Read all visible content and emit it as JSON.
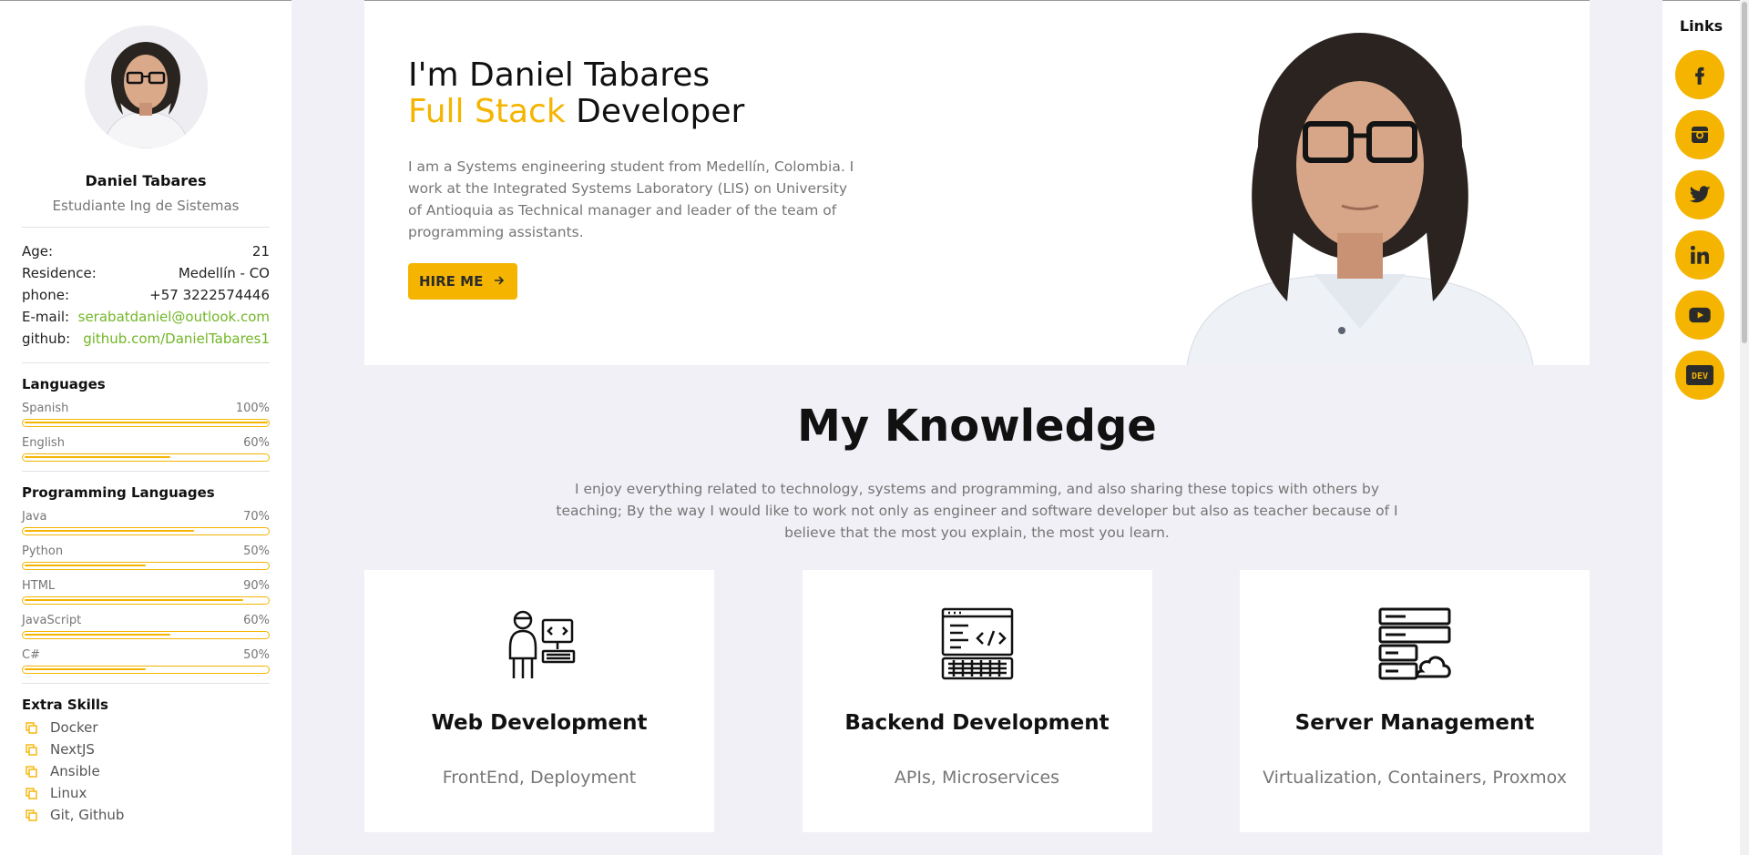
{
  "sidebar": {
    "name": "Daniel Tabares",
    "role": "Estudiante Ing de Sistemas",
    "info": [
      {
        "label": "Age:",
        "value": "21"
      },
      {
        "label": "Residence:",
        "value": "Medellín - CO"
      },
      {
        "label": "phone:",
        "value": "+57 3222574446"
      },
      {
        "label": "E-mail:",
        "value": "serabatdaniel@outlook.com"
      },
      {
        "label": "github:",
        "value": "github.com/DanielTabares1"
      }
    ],
    "languages_title": "Languages",
    "languages": [
      {
        "name": "Spanish",
        "percent": "100%",
        "level": 1.0
      },
      {
        "name": "English",
        "percent": "60%",
        "level": 0.6
      }
    ],
    "programming_title": "Programming Languages",
    "programming": [
      {
        "name": "Java",
        "percent": "70%",
        "level": 0.7
      },
      {
        "name": "Python",
        "percent": "50%",
        "level": 0.5
      },
      {
        "name": "HTML",
        "percent": "90%",
        "level": 0.9
      },
      {
        "name": "JavaScript",
        "percent": "60%",
        "level": 0.6
      },
      {
        "name": "C#",
        "percent": "50%",
        "level": 0.5
      }
    ],
    "extra_title": "Extra Skills",
    "extra": [
      "Docker",
      "NextJS",
      "Ansible",
      "Linux",
      "Git, Github"
    ]
  },
  "hero": {
    "line1": "I'm Daniel Tabares",
    "line2_accent": "Full Stack",
    "line2_rest": " Developer",
    "description": "I am a Systems engineering student from Medellín, Colombia. I work at the Integrated Systems Laboratory (LIS) on University of Antioquia as Technical manager and leader of the team of programming assistants.",
    "hire_label": "HIRE ME"
  },
  "knowledge": {
    "title": "My Knowledge",
    "description": "I enjoy everything related to technology, systems and programming, and also sharing these topics with others by teaching; By the way I would like to work not only as engineer and software developer but also as teacher because of I believe that the most you explain, the most you learn.",
    "cards": [
      {
        "title": "Web Development",
        "subtitle": "FrontEnd, Deployment",
        "icon": "web-developer-icon"
      },
      {
        "title": "Backend Development",
        "subtitle": "APIs, Microservices",
        "icon": "code-window-icon"
      },
      {
        "title": "Server Management",
        "subtitle": "Virtualization, Containers, Proxmox",
        "icon": "server-cloud-icon"
      }
    ]
  },
  "links": {
    "title": "Links",
    "items": [
      "facebook-icon",
      "instagram-icon",
      "twitter-icon",
      "linkedin-icon",
      "youtube-icon",
      "dev-icon"
    ],
    "dev_text": "DEV"
  },
  "colors": {
    "accent": "#f4b400",
    "link_green": "#72b626"
  }
}
